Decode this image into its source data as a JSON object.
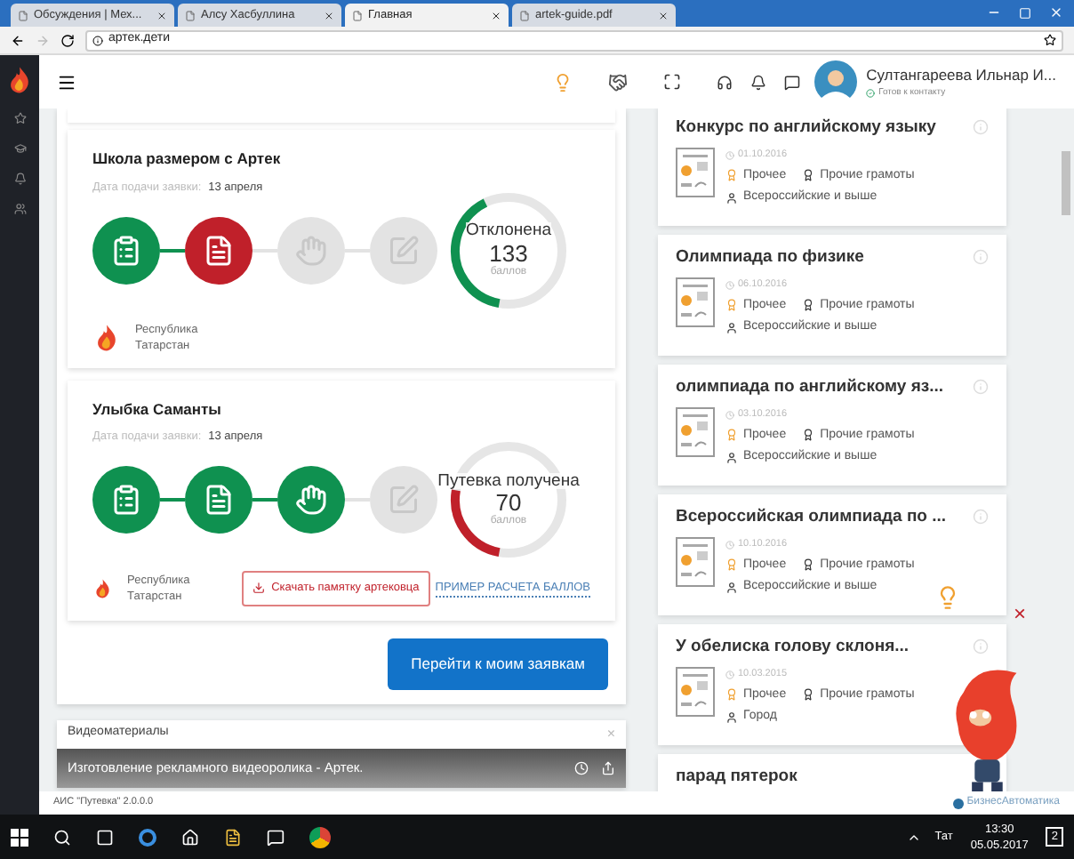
{
  "browser": {
    "tabs": [
      {
        "label": "Обсуждения | Мех...",
        "selected": false
      },
      {
        "label": "Алсу Хасбуллина",
        "selected": false
      },
      {
        "label": "Главная",
        "selected": true
      },
      {
        "label": "artek-guide.pdf",
        "selected": false
      }
    ],
    "address": "артек.дети"
  },
  "header": {
    "user_name": "Султангареева Ильнар И...",
    "user_status": "Готов к контакту"
  },
  "applications": [
    {
      "title": "Школа размером с Артек",
      "date_label": "Дата подачи заявки:",
      "date": "13 апреля",
      "steps": [
        {
          "color": "#0f9150"
        },
        {
          "color": "#c0202a"
        },
        {
          "color": "#e3e3e3"
        },
        {
          "color": "#e3e3e3"
        }
      ],
      "result": "Отклонена",
      "score": "133",
      "score_unit": "баллов",
      "level": 0.4,
      "color": "#0f9150",
      "region": "Республика Татарстан"
    },
    {
      "title": "Улыбка Саманты",
      "date_label": "Дата подачи заявки:",
      "date": "13 апреля",
      "steps": [
        {
          "color": "#0f9150"
        },
        {
          "color": "#0f9150"
        },
        {
          "color": "#0f9150"
        },
        {
          "color": "#e3e3e3"
        }
      ],
      "result": "Путевка получена",
      "score": "70",
      "score_unit": "баллов",
      "level": 0.25,
      "color": "#c0202a",
      "region": "Республика Татарстан",
      "download_button": "Скачать памятку артековца",
      "example_link": "ПРИМЕР РАСЧЕТА БАЛЛОВ"
    }
  ],
  "applications_button": "Перейти к моим заявкам",
  "video": {
    "heading": "Видеоматериалы",
    "close": "×",
    "title": "Изготовление рекламного видеоролика - Артек."
  },
  "achievements": [
    {
      "title": "Конкурс по английскому языку",
      "date": "01.10.2016",
      "category": "Прочее",
      "type": "Прочие грамоты",
      "level": "Всероссийские и выше"
    },
    {
      "title": "Олимпиада по физике",
      "date": "06.10.2016",
      "category": "Прочее",
      "type": "Прочие грамоты",
      "level": "Всероссийские и выше"
    },
    {
      "title": "олимпиада по английскому яз...",
      "date": "03.10.2016",
      "category": "Прочее",
      "type": "Прочие грамоты",
      "level": "Всероссийские и выше"
    },
    {
      "title": "Всероссийская олимпиада по ...",
      "date": "10.10.2016",
      "category": "Прочее",
      "type": "Прочие грамоты",
      "level": "Всероссийские и выше"
    },
    {
      "title": "У обелиска голову склоня...",
      "date": "10.03.2015",
      "category": "Прочее",
      "type": "Прочие грамоты",
      "level": "Город"
    },
    {
      "title": "парад пятерок"
    }
  ],
  "mascot": {
    "close": "×"
  },
  "footer": {
    "version": "АИС \"Путевка\" 2.0.0.0",
    "brand": "БизнесАвтоматика"
  },
  "taskbar": {
    "language": "Тат",
    "time": "13:30",
    "date": "05.05.2017",
    "notifications": "2"
  }
}
